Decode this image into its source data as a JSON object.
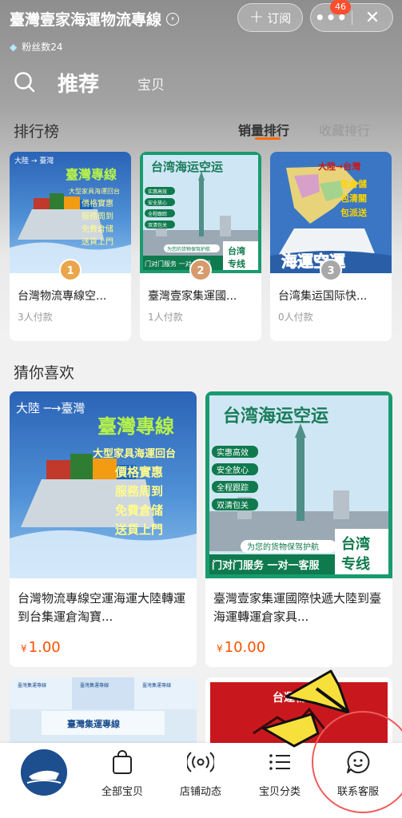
{
  "header": {
    "shop_name": "臺灣壹家海運物流專線",
    "fans": "粉丝数24",
    "subscribe": "订阅",
    "more_badge": "46"
  },
  "tabs": {
    "recommend": "推荐",
    "items": "宝贝"
  },
  "ranking": {
    "title": "排行榜",
    "tab_sales": "销量排行",
    "tab_fav": "收藏排行",
    "items": [
      {
        "rank": "1",
        "name": "台灣物流專線空...",
        "paid": "3人付款",
        "medal_color": "#e9a64a"
      },
      {
        "rank": "2",
        "name": "臺灣壹家集運國...",
        "paid": "1人付款",
        "medal_color": "#d79a6b"
      },
      {
        "rank": "3",
        "name": "台湾集运国际快...",
        "paid": "0人付款",
        "medal_color": "#a8a8a8"
      }
    ]
  },
  "guess": {
    "title": "猜你喜欢",
    "items": [
      {
        "name": "台灣物流專線空運海運大陸轉運到台集運倉淘寶...",
        "currency": "¥",
        "price": "1.00"
      },
      {
        "name": "臺灣壹家集運國際快遞大陸到臺海運轉運倉家具...",
        "currency": "¥",
        "price": "10.00"
      }
    ]
  },
  "posters": {
    "route_cn_tw": "大陸 → 臺灣",
    "route_cn_tw_short": "大陸 ─→臺灣",
    "poster1_title": "臺灣專線",
    "poster1_lines": [
      "大型家具海運回台",
      "價格實惠",
      "服務周到",
      "免費倉储",
      "送貨上門"
    ],
    "poster2_title": "台湾海运空运",
    "poster2_tags": [
      "实惠高效",
      "安全放心",
      "全程跟踪",
      "双清包关"
    ],
    "poster2_slogan": "为您的货物保驾护航",
    "poster2_bottom": "门对门服务 一对一客服",
    "poster2_corner": [
      "台湾",
      "专线"
    ],
    "poster3_route": "大陸→台灣",
    "poster3_tags": [
      "免倉儲",
      "包清關",
      "包派送"
    ],
    "poster3_title": "海運空運",
    "poster4_title": "臺灣集運專線",
    "poster4_header": "臺灣集運專線",
    "poster5_text": "台運物"
  },
  "bottom_nav": {
    "all_items": "全部宝贝",
    "shop_news": "店铺动态",
    "categories": "宝贝分类",
    "contact": "联系客服"
  },
  "colors": {
    "accent": "#ff6a00",
    "price": "#ff5000",
    "annotation_red": "#f05a5a",
    "annotation_yellow": "#f7e03c"
  }
}
